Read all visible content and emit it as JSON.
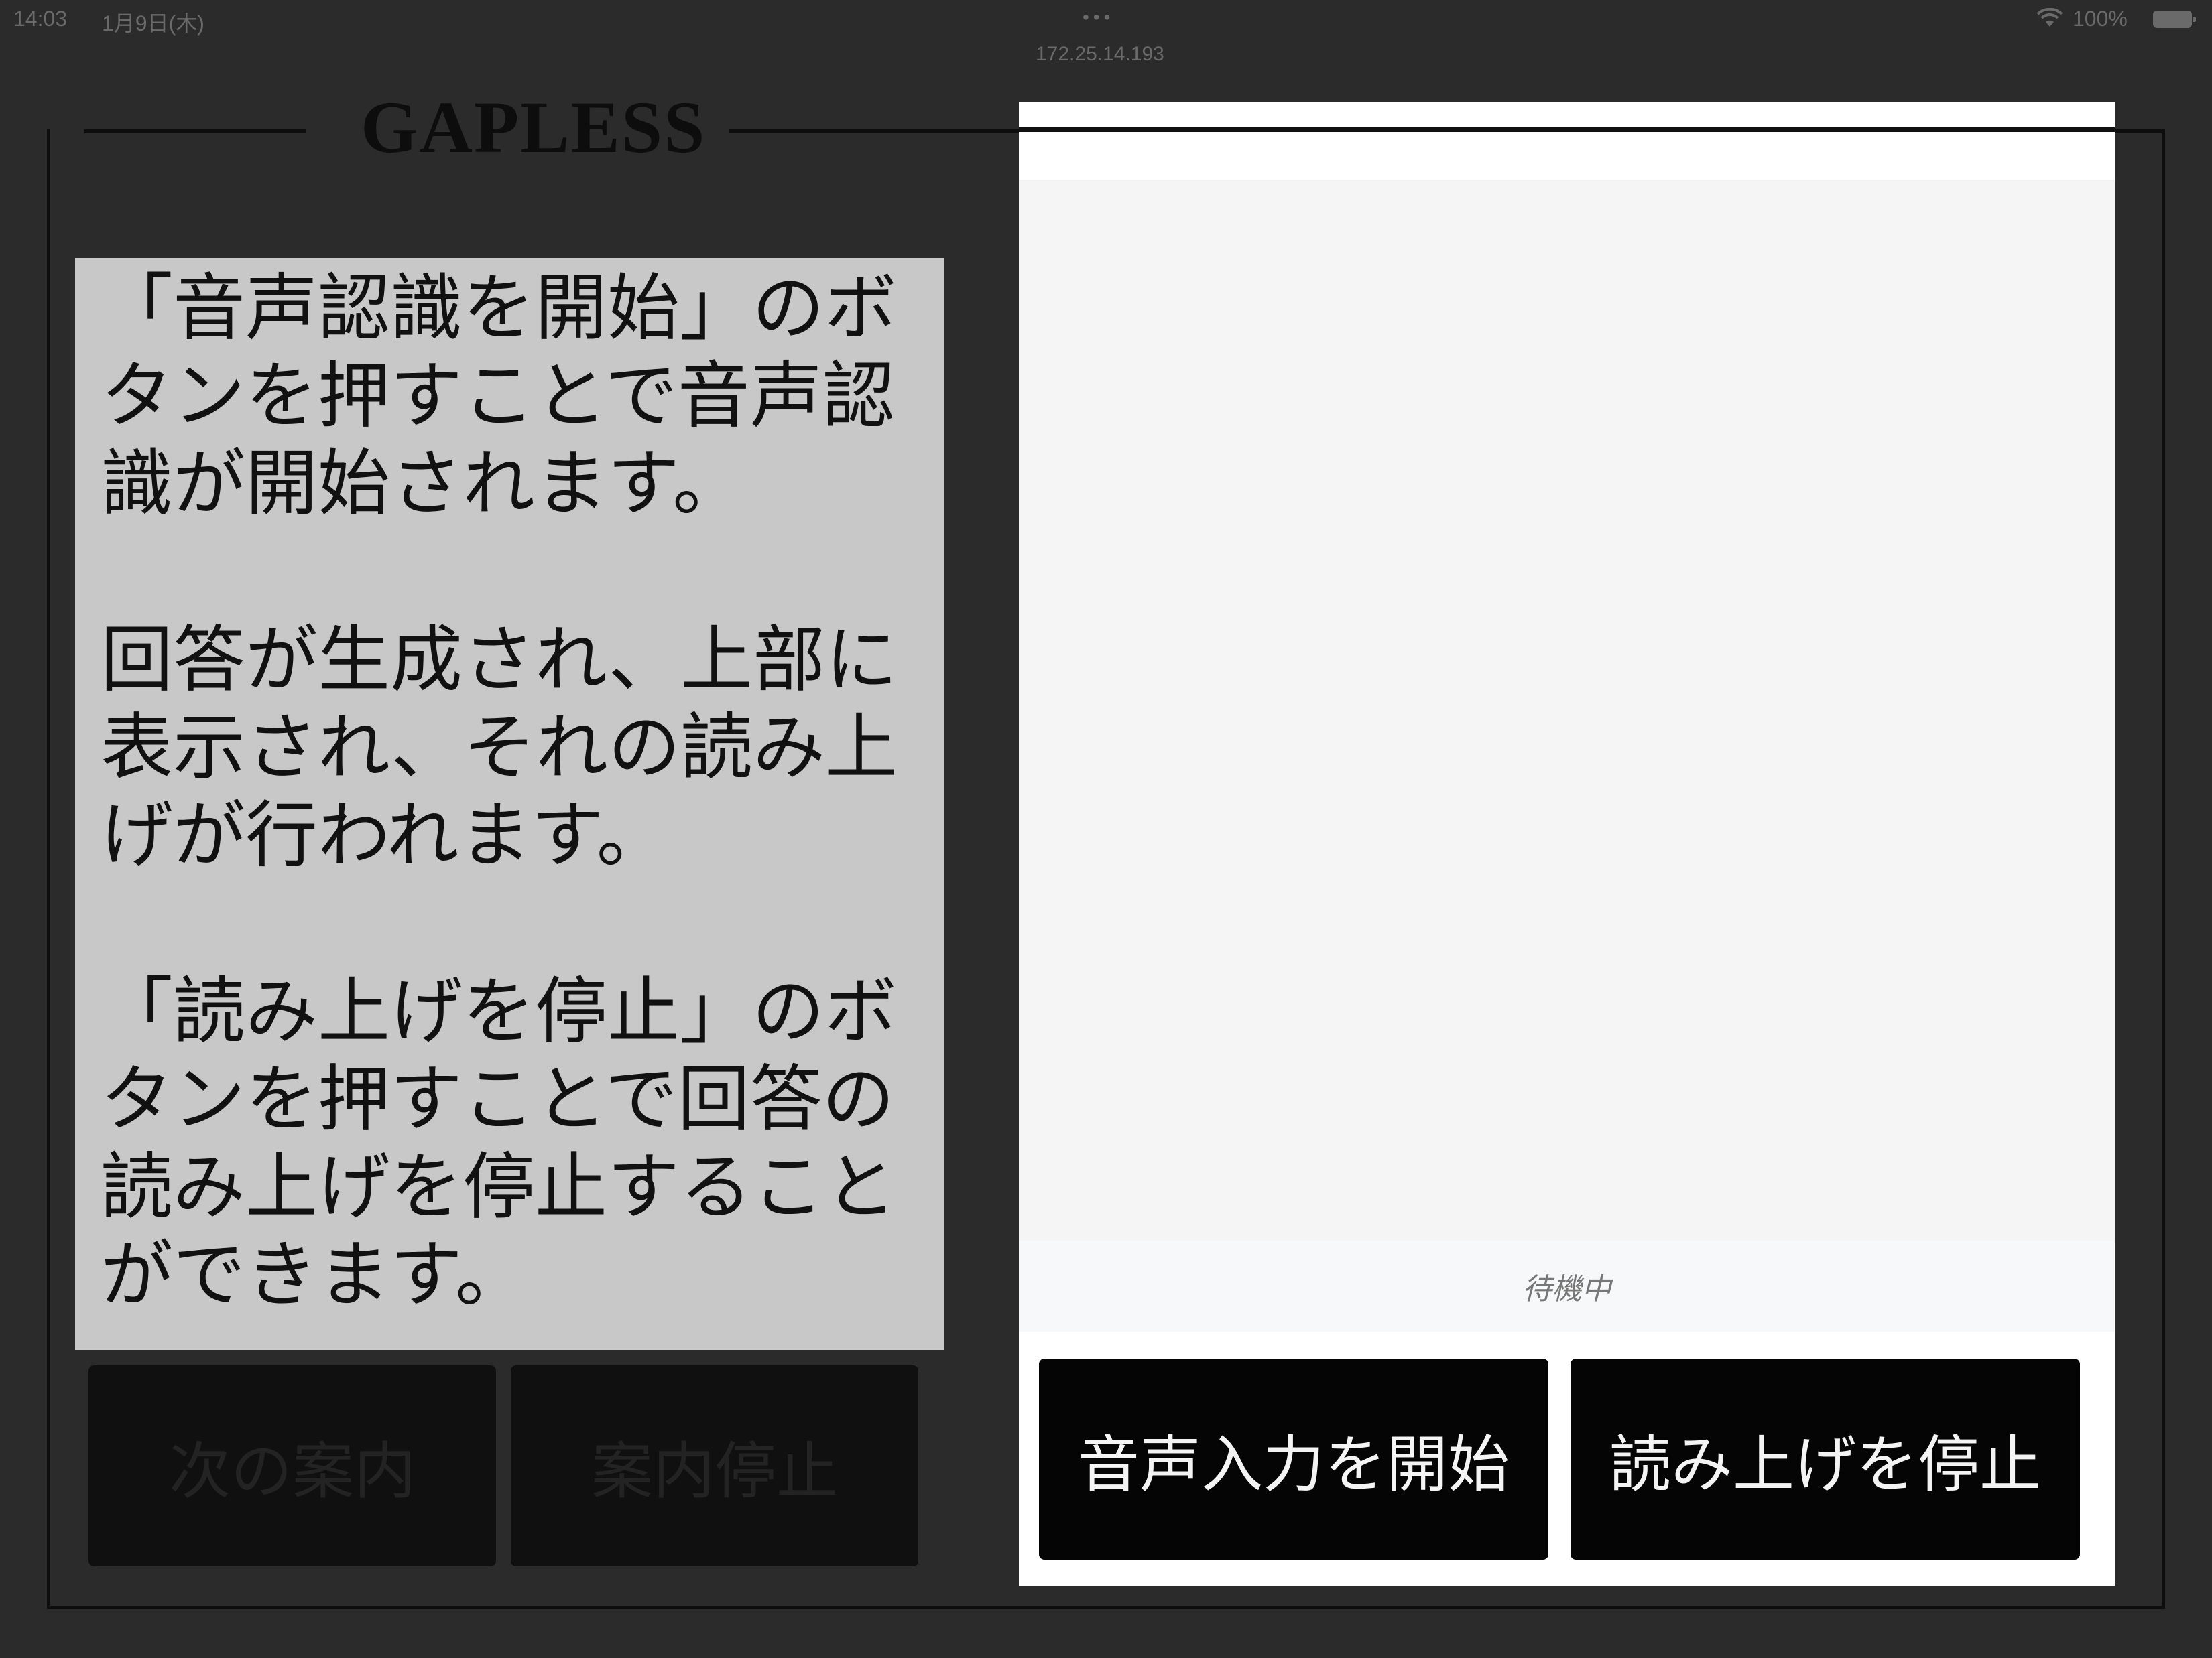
{
  "status_bar": {
    "time": "14:03",
    "date": "1月9日(木)",
    "dots": "•••",
    "address": "172.25.14.193",
    "battery": "100%",
    "wifi_icon": "wifi-icon",
    "battery_icon": "battery-icon"
  },
  "app": {
    "title": "GAPLESS",
    "next_button": "次の案内",
    "stop_button": "案内停止"
  },
  "help": {
    "paragraphs": [
      "「音声認識を開始」のボ\nタンを押すことで音声認\n識が開始されます。",
      "回答が生成され、上部に\n表示され、それの読み上\nげが行われます。",
      "「読み上げを停止」のボ\nタンを押すことで回答の\n読み上げを停止すること\nができます。"
    ]
  },
  "dialog": {
    "status_text": "待機中",
    "start_button": "音声入力を開始",
    "stop_read_button": "読み上げを停止"
  },
  "colors": {
    "overlay_background": "#2b2b2b",
    "help_panel": "#c8c8c8",
    "dialog_button": "#050505"
  }
}
